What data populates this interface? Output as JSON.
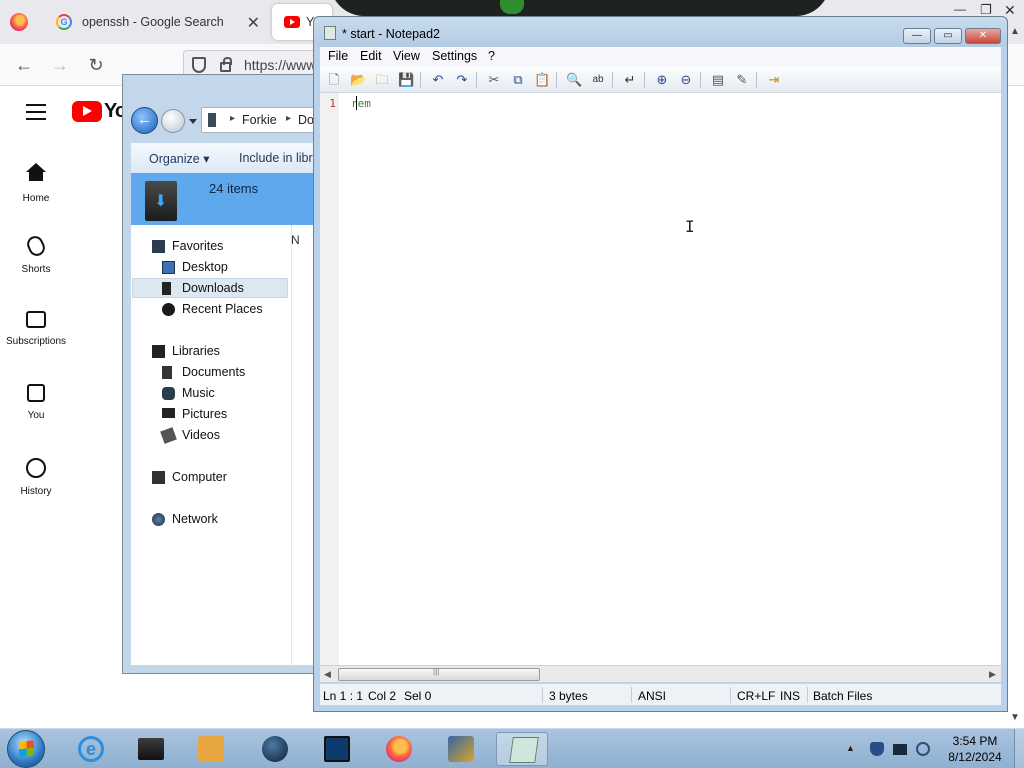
{
  "browser": {
    "tabs": [
      {
        "label": "openssh - Google Search",
        "close": "✕"
      },
      {
        "label": "Yo"
      }
    ],
    "url": "https://www",
    "nav": {
      "back": "←",
      "forward": "→",
      "reload": "↻"
    },
    "controls": {
      "minimize": "—",
      "maximize": "❐",
      "close": "✕"
    },
    "scroll_up": "▲",
    "scroll_down": "▼"
  },
  "youtube": {
    "logo_text": "Yo",
    "nav": [
      {
        "label": "Home",
        "icon": "home-icon"
      },
      {
        "label": "Shorts",
        "icon": "shorts-icon"
      },
      {
        "label": "Subscriptions",
        "icon": "subscriptions-icon"
      },
      {
        "label": "You",
        "icon": "you-icon"
      },
      {
        "label": "History",
        "icon": "history-icon"
      }
    ]
  },
  "explorer": {
    "breadcrumb": [
      "Forkie",
      "Do"
    ],
    "toolbar": {
      "organize": "Organize ▾",
      "include": "Include in libr"
    },
    "details": {
      "count": "24 items"
    },
    "nav": {
      "favorites": "Favorites",
      "desktop": "Desktop",
      "downloads": "Downloads",
      "recent": "Recent Places",
      "libraries": "Libraries",
      "documents": "Documents",
      "music": "Music",
      "pictures": "Pictures",
      "videos": "Videos",
      "computer": "Computer",
      "network": "Network"
    },
    "right_col_letter": "N"
  },
  "notepad": {
    "title": "* start - Notepad2",
    "controls": {
      "minimize": "—",
      "maximize": "▭",
      "close": "✕"
    },
    "menu": [
      "File",
      "Edit",
      "View",
      "Settings",
      "?"
    ],
    "editor": {
      "line_number": "1",
      "line_text": "rem"
    },
    "hscroll": {
      "left": "◀",
      "right": "▶"
    },
    "status": {
      "position": "Ln 1 : 1",
      "column": "Col 2",
      "selection": "Sel 0",
      "size": "3 bytes",
      "encoding": "ANSI",
      "line_endings": "CR+LF",
      "mode": "INS",
      "scheme": "Batch Files"
    }
  },
  "taskbar": {
    "clock_time": "3:54 PM",
    "clock_date": "8/12/2024",
    "tray_arrow": "▲"
  }
}
